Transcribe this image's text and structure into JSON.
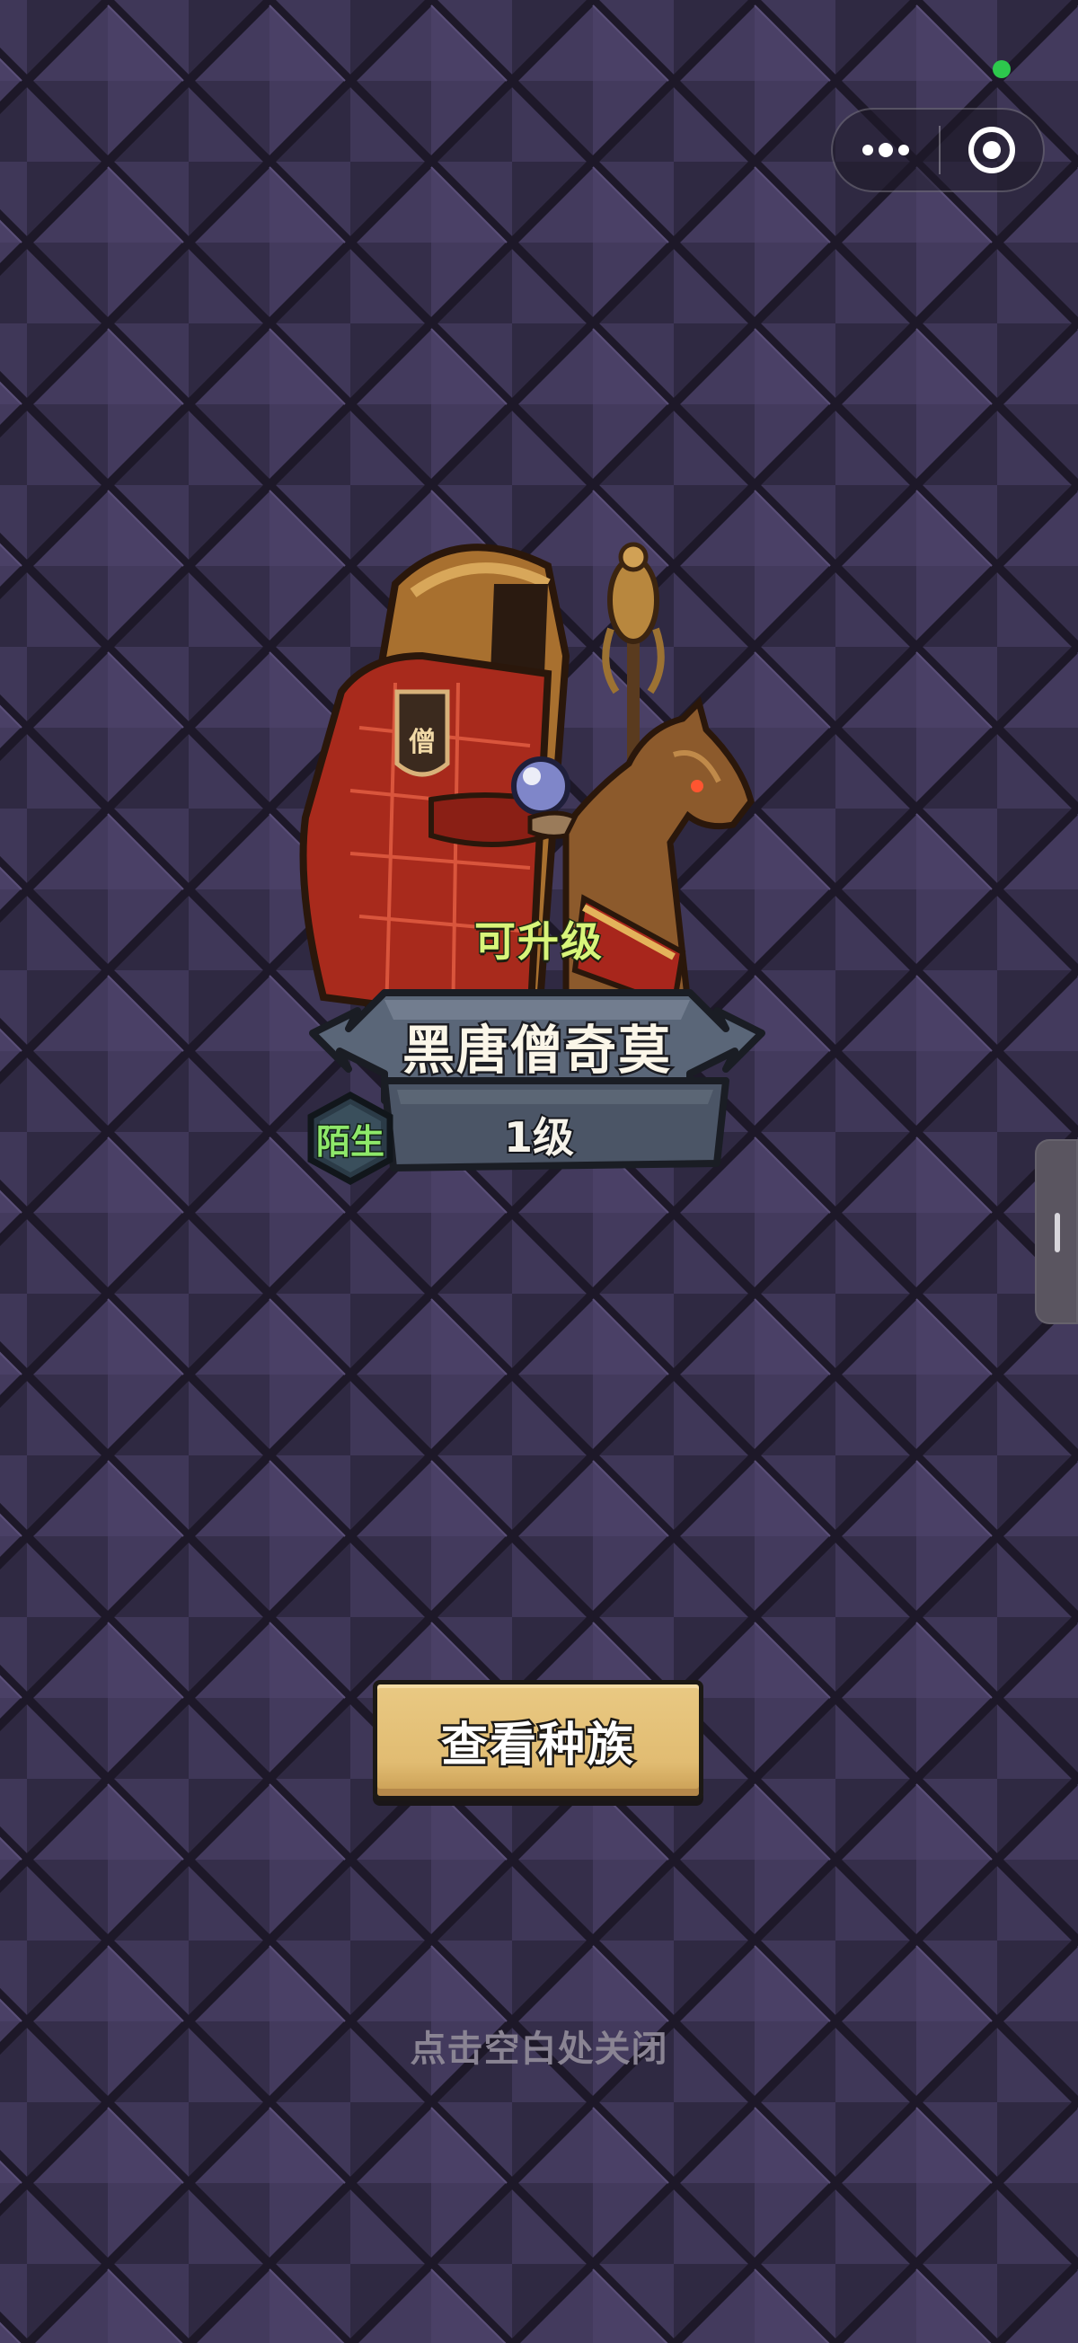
{
  "capsule": {
    "more_icon": "more-dots-icon",
    "close_icon": "target-close-icon",
    "status_color": "#2dc84d"
  },
  "character": {
    "upgrade_tag": "可升级",
    "name": "黑唐僧奇莫",
    "level": "1级",
    "relation": "陌生",
    "robe_badge": "僧"
  },
  "actions": {
    "view_race": "查看种族",
    "close_hint": "点击空白处关闭"
  },
  "colors": {
    "background": "#3a3250",
    "upgrade_text": "#d8f57a",
    "relation_text": "#8ee86a",
    "button_gold": "#e1bc72"
  }
}
